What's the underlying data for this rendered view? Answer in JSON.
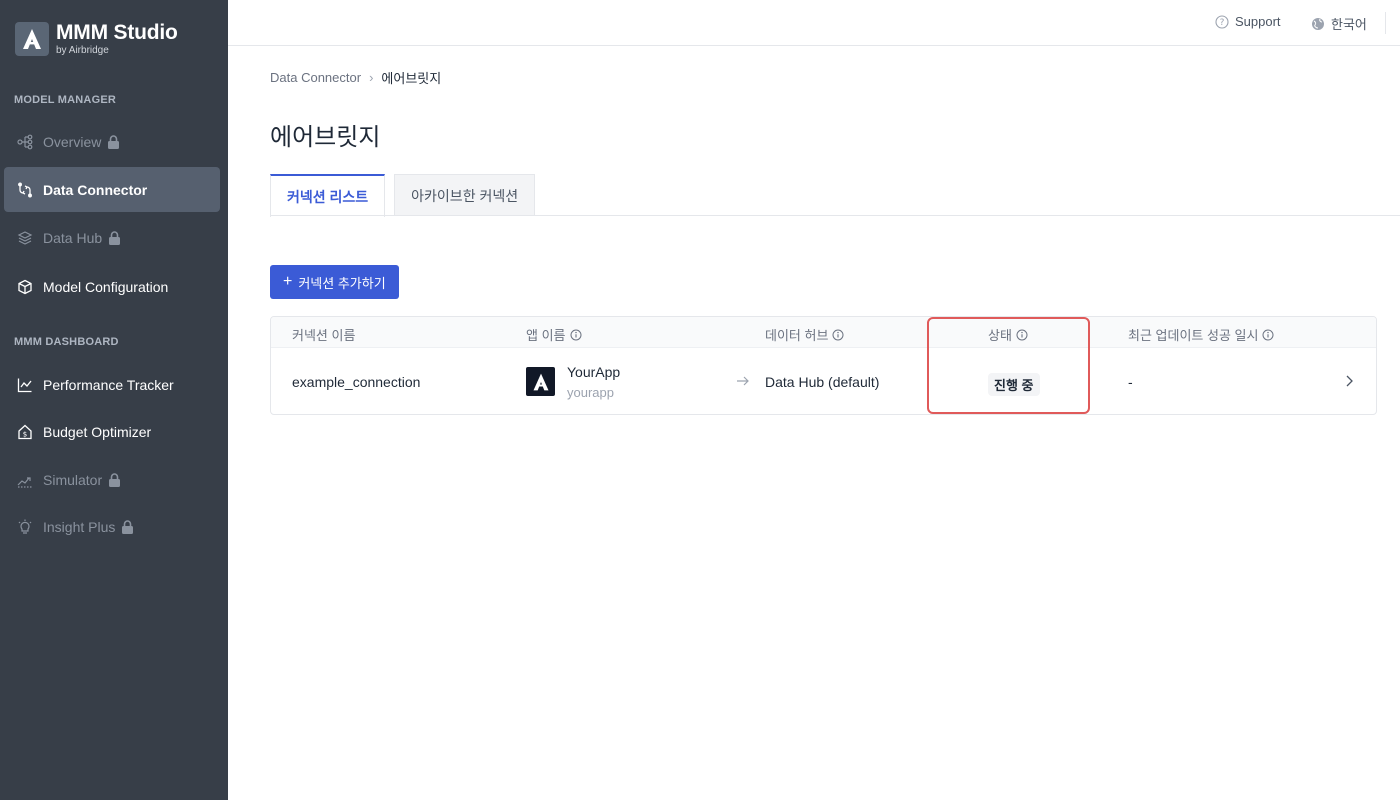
{
  "brand": {
    "title": "MMM Studio",
    "subtitle": "by Airbridge",
    "mark_letter": "A"
  },
  "sidebar": {
    "sections": [
      {
        "label": "MODEL MANAGER"
      },
      {
        "label": "MMM DASHBOARD"
      }
    ],
    "items": [
      {
        "label": "Overview",
        "icon": "hierarchy-icon",
        "locked": true,
        "active": false
      },
      {
        "label": "Data Connector",
        "icon": "connector-icon",
        "locked": false,
        "active": true
      },
      {
        "label": "Data Hub",
        "icon": "layers-icon",
        "locked": true,
        "active": false
      },
      {
        "label": "Model Configuration",
        "icon": "cube-icon",
        "locked": false,
        "active": false
      },
      {
        "label": "Performance Tracker",
        "icon": "line-chart-icon",
        "locked": false,
        "active": false
      },
      {
        "label": "Budget Optimizer",
        "icon": "house-dollar-icon",
        "locked": false,
        "active": false
      },
      {
        "label": "Simulator",
        "icon": "trend-icon",
        "locked": true,
        "active": false
      },
      {
        "label": "Insight Plus",
        "icon": "lightbulb-icon",
        "locked": true,
        "active": false
      }
    ]
  },
  "topbar": {
    "support_label": "Support",
    "language_label": "한국어"
  },
  "breadcrumb": {
    "parent": "Data Connector",
    "separator": "›",
    "current": "에어브릿지"
  },
  "page_title": "에어브릿지",
  "tabs": [
    {
      "label": "커넥션 리스트",
      "active": true
    },
    {
      "label": "아카이브한 커넥션",
      "active": false
    }
  ],
  "add_button": {
    "icon": "+",
    "label": "커넥션 추가하기"
  },
  "table": {
    "headers": {
      "connection_name": "커넥션 이름",
      "app_name": "앱 이름",
      "data_hub": "데이터 허브",
      "status": "상태",
      "last_success": "최근 업데이트 성공 일시"
    },
    "rows": [
      {
        "connection_name": "example_connection",
        "app_name": "YourApp",
        "app_id": "yourapp",
        "app_logo_letter": "A",
        "data_hub": "Data Hub (default)",
        "status": "진행 중",
        "last_success": "-"
      }
    ]
  },
  "colors": {
    "sidebar_bg": "#373e48",
    "sidebar_active": "#56606f",
    "accent": "#3b5bd6",
    "highlight": "#e05a5a"
  }
}
